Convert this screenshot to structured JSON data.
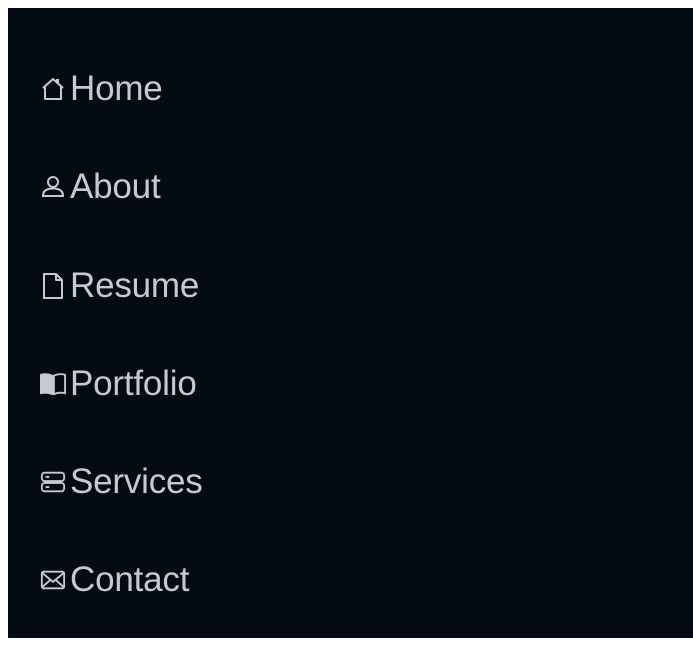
{
  "nav": {
    "colors": {
      "background": "#050b14",
      "text": "#c6c9cf",
      "icon": "#c6c9cf"
    },
    "items": [
      {
        "label": "Home",
        "icon": "house-icon"
      },
      {
        "label": "About",
        "icon": "person-icon"
      },
      {
        "label": "Resume",
        "icon": "file-icon"
      },
      {
        "label": "Portfolio",
        "icon": "book-icon"
      },
      {
        "label": "Services",
        "icon": "server-icon"
      },
      {
        "label": "Contact",
        "icon": "envelope-icon"
      }
    ]
  }
}
